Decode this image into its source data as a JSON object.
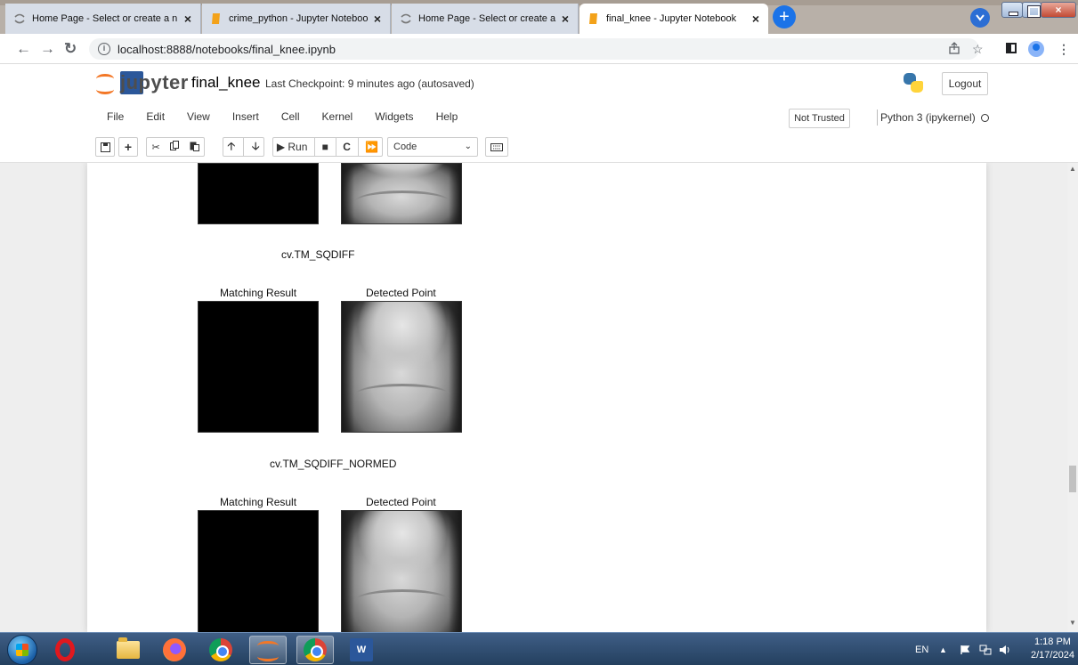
{
  "browser": {
    "tabs": [
      {
        "title": "Home Page - Select or create a n",
        "active": false,
        "favicon": "jupyter-icon"
      },
      {
        "title": "crime_python - Jupyter Noteboo",
        "active": false,
        "favicon": "notebook-icon"
      },
      {
        "title": "Home Page - Select or create a n",
        "active": false,
        "favicon": "jupyter-icon"
      },
      {
        "title": "final_knee - Jupyter Notebook",
        "active": true,
        "favicon": "notebook-icon"
      }
    ],
    "close_glyph": "×",
    "new_tab_glyph": "+",
    "url": "localhost:8888/notebooks/final_knee.ipynb"
  },
  "jupyter": {
    "logo_text": "jupyter",
    "notebook_name": "final_knee",
    "checkpoint": "Last Checkpoint: 9 minutes ago  (autosaved)",
    "logout_label": "Logout",
    "menus": [
      "File",
      "Edit",
      "View",
      "Insert",
      "Cell",
      "Kernel",
      "Widgets",
      "Help"
    ],
    "trusted_label": "Not Trusted",
    "kernel_label": "Python 3 (ipykernel)",
    "toolbar": {
      "run_label": "Run",
      "cell_type": "Code"
    }
  },
  "output": {
    "sections": [
      {
        "title": "",
        "left_label": "",
        "right_label": ""
      },
      {
        "title": "cv.TM_SQDIFF",
        "left_label": "Matching Result",
        "right_label": "Detected Point"
      },
      {
        "title": "cv.TM_SQDIFF_NORMED",
        "left_label": "Matching Result",
        "right_label": "Detected Point"
      }
    ]
  },
  "taskbar": {
    "language": "EN",
    "time": "1:18 PM",
    "date": "2/17/2024"
  },
  "colors": {
    "jupyter_orange": "#f37726",
    "new_tab_blue": "#1b73e8",
    "taskbar": "#2f4d72"
  }
}
